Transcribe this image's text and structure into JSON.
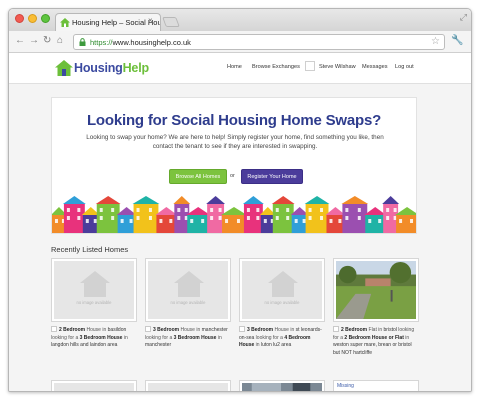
{
  "browser": {
    "tab_title": "Housing Help – Social Housin",
    "tab_close": "×",
    "url_https": "https://",
    "url_rest": "www.housinghelp.co.uk",
    "back_icon": "back-arrow-icon",
    "forward_icon": "forward-arrow-icon",
    "reload_icon": "reload-icon",
    "home_icon": "home-icon",
    "star_icon": "star-icon",
    "wrench_icon": "wrench-icon"
  },
  "site": {
    "logo_part1": "Housing",
    "logo_part2": "Help",
    "nav": {
      "home": "Home",
      "browse": "Browse Exchanges",
      "user": "Steve Wilshaw",
      "messages": "Messages",
      "logout": "Log out"
    },
    "colors": {
      "brand_blue": "#2e3c8d",
      "brand_green": "#7cc33e",
      "brand_purple": "#4b3c9b"
    }
  },
  "hero": {
    "title": "Looking for Social Housing Home Swaps?",
    "lead": "Looking to swap your home? We are here to help! Simply register your home, find something you like, then contact the tenant to see if they are interested in swapping.",
    "btn_browse": "Browse All Homes",
    "or": "or",
    "btn_register": "Register Your Home"
  },
  "recent": {
    "title": "Recently Listed Homes",
    "no_image": "no image available",
    "missing": "Missing",
    "cards": [
      {
        "p1": "2 Bedroom",
        "p2": " House in ",
        "p3": "basildon",
        "p4": " looking for a ",
        "p5": "3 Bedroom House",
        "p6": " in ",
        "p7": "langdon hills and laindon area"
      },
      {
        "p1": "3 Bedroom",
        "p2": " House in ",
        "p3": "manchester",
        "p4": " looking for a ",
        "p5": "3 Bedroom House",
        "p6": " in ",
        "p7": "manchester"
      },
      {
        "p1": "3 Bedroom",
        "p2": " House in ",
        "p3": "st leonards-on-sea",
        "p4": " looking for a ",
        "p5": "4 Bedroom House",
        "p6": " in ",
        "p7": "luton lu2 area"
      },
      {
        "p1": "2 Bedroom",
        "p2": " Flat in ",
        "p3": "bristol",
        "p4": " looking for a ",
        "p5": "2 Bedroom House or Flat",
        "p6": " in ",
        "p7": "weston super mare, brean or bristol but NOT hartcliffe"
      }
    ]
  }
}
